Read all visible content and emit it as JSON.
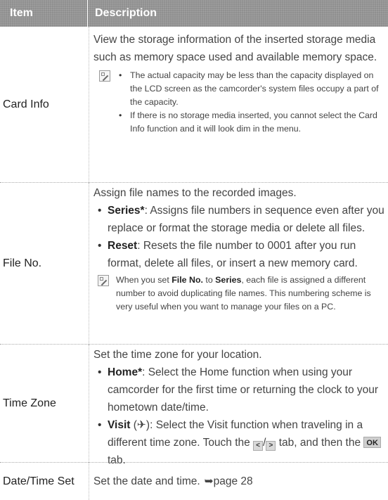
{
  "header": {
    "item": "Item",
    "description": "Description"
  },
  "card_info": {
    "item": "Card Info",
    "desc": "View the storage information of the inserted storage media such as memory space used and available memory space.",
    "notes": [
      "The actual capacity may be less than the capacity displayed on the LCD screen as the camcorder's system files occupy a part of the capacity.",
      "If there is no storage media inserted, you cannot select the Card Info function and it will look dim in the menu."
    ]
  },
  "file_no": {
    "item": "File No.",
    "desc": "Assign file names to the recorded images.",
    "series_label": "Series*",
    "series_text": ": Assigns file numbers in sequence even after you replace or format the storage media or delete all files.",
    "reset_label": "Reset",
    "reset_text": ": Resets the file number to 0001 after you run format, delete all files, or insert a new memory card.",
    "note_pre": "When you set ",
    "note_b1": "File No.",
    "note_mid": " to ",
    "note_b2": "Series",
    "note_post": ", each file is assigned a different number to avoid duplicating file names. This numbering scheme is very useful when you want to manage your files on a PC."
  },
  "time_zone": {
    "item": "Time Zone",
    "desc": "Set the time zone for your location.",
    "home_label": "Home*",
    "home_text": ": Select the Home function when using your camcorder for the first time or returning the clock to your hometown date/time.",
    "visit_label": "Visit",
    "visit_icon": "(✈)",
    "visit_text1": ": Select the Visit function when traveling in a different time zone. Touch the",
    "visit_text2": "tab, and then the",
    "visit_text3": "tab.",
    "prev_tab": "<",
    "next_tab": ">",
    "slash": "/",
    "ok": "OK"
  },
  "date_time": {
    "item": "Date/Time Set",
    "desc": "Set the date and time.",
    "ref": "➥page 28"
  }
}
